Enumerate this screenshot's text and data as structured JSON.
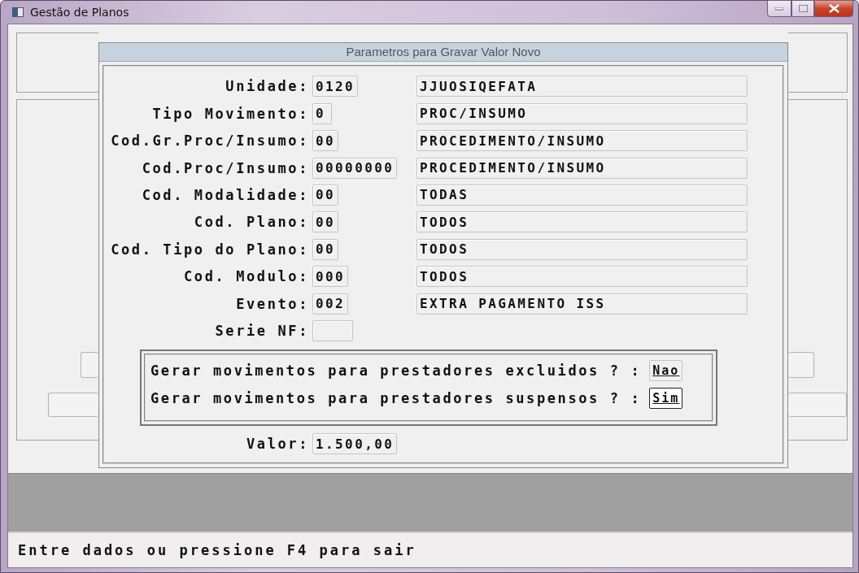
{
  "window": {
    "title": "Gestão de Planos"
  },
  "dialog": {
    "title": "Parametros para Gravar Valor Novo",
    "fields": [
      {
        "label": "Unidade:",
        "code": "0120",
        "description": "JJUOSIQEFATA"
      },
      {
        "label": "Tipo Movimento:",
        "code": "0",
        "description": "PROC/INSUMO"
      },
      {
        "label": "Cod.Gr.Proc/Insumo:",
        "code": "00",
        "description": "PROCEDIMENTO/INSUMO"
      },
      {
        "label": "Cod.Proc/Insumo:",
        "code": "00000000",
        "description": "PROCEDIMENTO/INSUMO"
      },
      {
        "label": "Cod. Modalidade:",
        "code": "00",
        "description": "TODAS"
      },
      {
        "label": "Cod. Plano:",
        "code": "00",
        "description": "TODOS"
      },
      {
        "label": "Cod. Tipo do Plano:",
        "code": "00",
        "description": "TODOS"
      },
      {
        "label": "Cod. Modulo:",
        "code": "000",
        "description": "TODOS"
      },
      {
        "label": "Evento:",
        "code": "002",
        "description": "EXTRA PAGAMENTO ISS"
      },
      {
        "label": "Serie NF:"
      }
    ],
    "popup": {
      "questions": [
        {
          "text": "Gerar movimentos para prestadores excluidos ? :",
          "answer": "Nao",
          "selected": false
        },
        {
          "text": "Gerar movimentos para prestadores suspensos ? :",
          "answer": "Sim",
          "selected": true
        }
      ]
    },
    "fields_after": [
      {
        "label": "Valor:",
        "code": "1.500,00"
      }
    ]
  },
  "status_bar": {
    "message": "Entre dados ou pressione F4 para sair"
  }
}
